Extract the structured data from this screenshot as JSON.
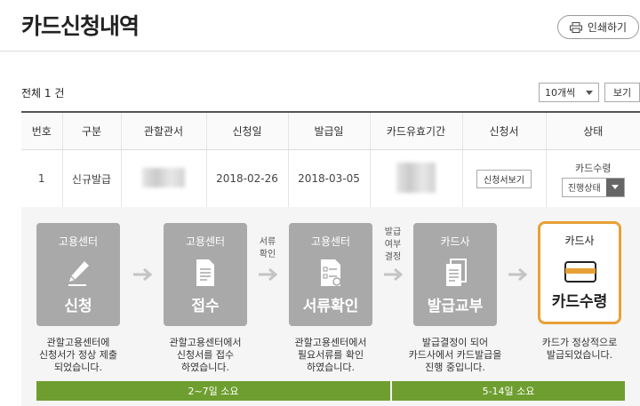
{
  "header": {
    "title": "카드신청내역",
    "print_label": "인쇄하기"
  },
  "toolbar": {
    "total_text": "전체 1 건",
    "count_select": "10개씩",
    "view_label": "보기"
  },
  "table": {
    "columns": [
      "번호",
      "구분",
      "관할관서",
      "신청일",
      "발급일",
      "카드유효기간",
      "신청서",
      "상태"
    ],
    "row": {
      "no": "1",
      "type": "신규발급",
      "apply_date": "2018-02-26",
      "issue_date": "2018-03-05",
      "form_button": "신청서보기",
      "status_label": "카드수령",
      "status_select": "진행상태"
    }
  },
  "process": {
    "steps": [
      {
        "top": "고용센터",
        "bottom": "신청",
        "icon": "pencil-icon",
        "desc": [
          "관할고용센터에",
          "신청서가 정상 제출",
          "되었습니다."
        ]
      },
      {
        "top": "고용센터",
        "bottom": "접수",
        "icon": "document-icon",
        "desc": [
          "관할고용센터에서",
          "신청서를 접수",
          "하였습니다."
        ]
      },
      {
        "top": "고용센터",
        "bottom": "서류확인",
        "icon": "checklist-icon",
        "desc": [
          "관할고용센터에서",
          "필요서류를 확인",
          "하였습니다."
        ]
      },
      {
        "top": "카드사",
        "bottom": "발급교부",
        "icon": "documents-icon",
        "desc": [
          "발급결정이 되어",
          "카드사에서 카드발급을",
          "진행 중입니다."
        ]
      },
      {
        "top": "카드사",
        "bottom": "카드수령",
        "icon": "card-icon",
        "desc": [
          "카드가 정상적으로",
          "발급되었습니다."
        ]
      }
    ],
    "between_labels": [
      [
        "서류",
        "확인"
      ],
      [
        "발급",
        "여부",
        "결정"
      ]
    ],
    "durations": [
      "2~7일 소요",
      "5-14일 소요"
    ],
    "colors": {
      "active_border": "#e8a035",
      "inactive_step": "#a9a9a9",
      "bar": "#6e9e2f",
      "card_stripe": "#e8a035"
    }
  }
}
